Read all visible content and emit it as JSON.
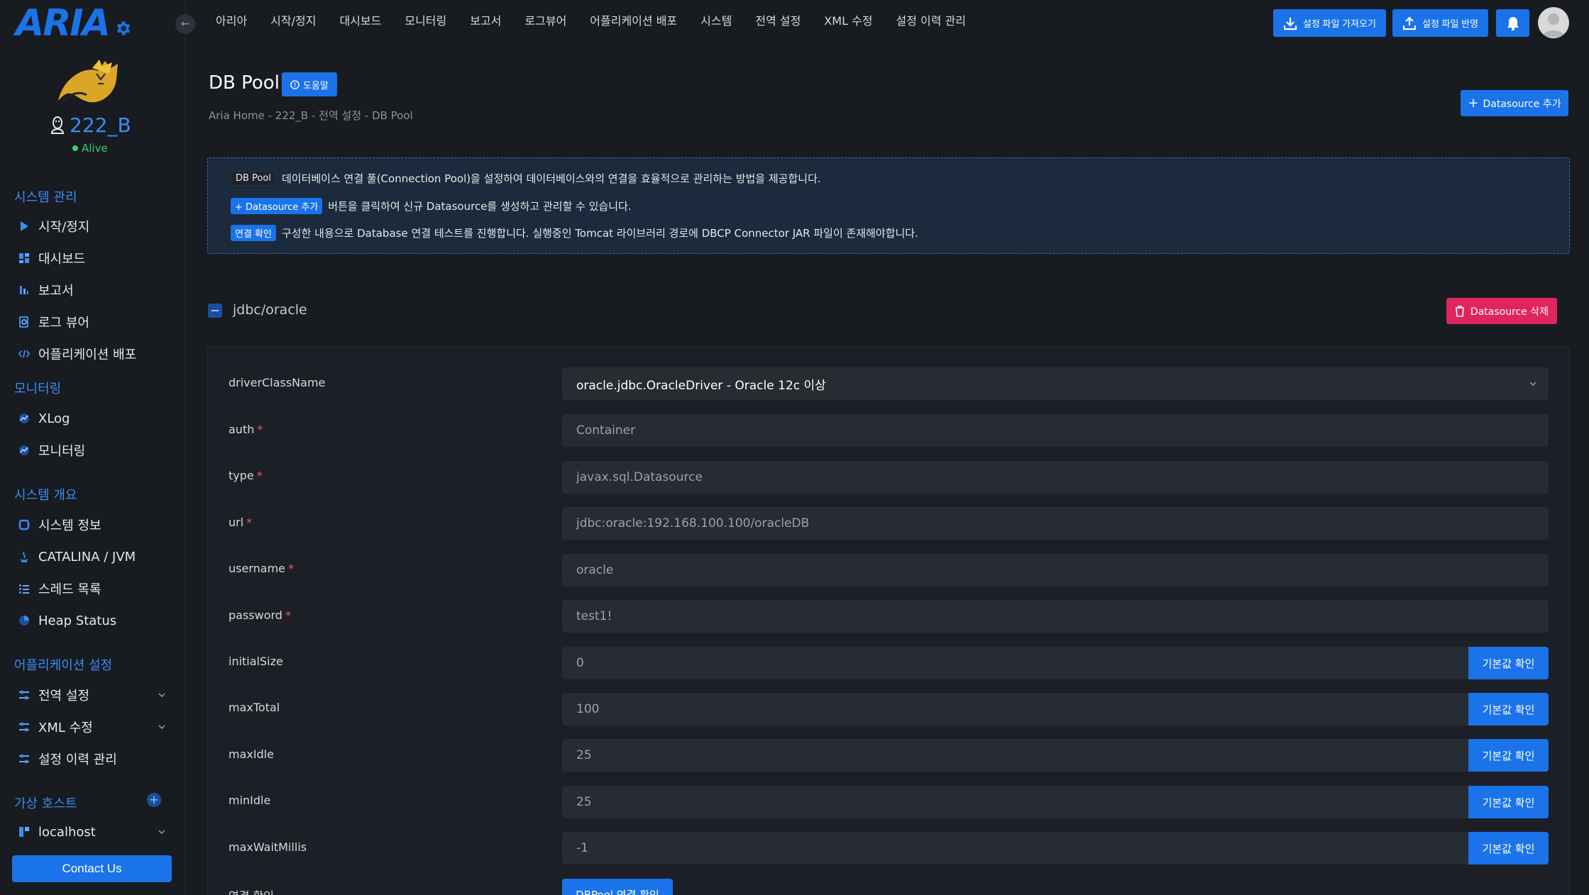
{
  "brand": {
    "logo_text": "ARIA"
  },
  "server": {
    "name": "222_B",
    "status": "Alive"
  },
  "sidebar": {
    "sections": [
      {
        "label": "시스템 관리"
      },
      {
        "label": "모니터링"
      },
      {
        "label": "시스템 개요"
      },
      {
        "label": "어플리케이션 설정"
      },
      {
        "label": "가상 호스트"
      }
    ],
    "items": [
      {
        "label": "시작/정지",
        "icon": "play-icon"
      },
      {
        "label": "대시보드",
        "icon": "dashboard-icon"
      },
      {
        "label": "보고서",
        "icon": "report-icon"
      },
      {
        "label": "로그 뷰어",
        "icon": "log-viewer-icon"
      },
      {
        "label": "어플리케이션 배포",
        "icon": "code-icon"
      },
      {
        "label": "XLog",
        "icon": "xlog-icon"
      },
      {
        "label": "모니터링",
        "icon": "monitoring-icon"
      },
      {
        "label": "시스템 정보",
        "icon": "chip-icon"
      },
      {
        "label": "CATALINA / JVM",
        "icon": "java-icon"
      },
      {
        "label": "스레드 목록",
        "icon": "thread-list-icon"
      },
      {
        "label": "Heap Status",
        "icon": "pie-icon"
      },
      {
        "label": "전역 설정",
        "icon": "sliders-icon"
      },
      {
        "label": "XML 수정",
        "icon": "sliders-icon"
      },
      {
        "label": "설정 이력 관리",
        "icon": "sliders-icon"
      },
      {
        "label": "localhost",
        "icon": "host-icon"
      }
    ],
    "contact_label": "Contact Us"
  },
  "topnav": {
    "items": [
      "아리아",
      "시작/정지",
      "대시보드",
      "모니터링",
      "보고서",
      "로그뷰어",
      "어플리케이션 배포",
      "시스템",
      "전역 설정",
      "XML 수정",
      "설정 이력 관리"
    ],
    "import_label": "설정 파일 가져오기",
    "apply_label": "설정 파일 반영"
  },
  "page": {
    "title": "DB Pool",
    "help_label": "도움말",
    "breadcrumb": "Aria Home  -  222_B  -  전역 설정  -  DB Pool",
    "add_datasource_label": "Datasource 추가"
  },
  "info": {
    "tag1": "DB Pool",
    "line1": "데이터베이스 연결 풀(Connection Pool)을 설정하여 데이터베이스와의 연결을 효율적으로 관리하는 방법을 제공합니다.",
    "tag2": "+ Datasource 추가",
    "line2": "버튼을 클릭하여 신규 Datasource를 생성하고 관리할 수 있습니다.",
    "tag3": "연결 확인",
    "line3": "구성한 내용으로 Database 연결 테스트를 진행합니다. 실행중인 Tomcat 라이브러리 경로에 DBCP Connector JAR 파일이 존재해야합니다."
  },
  "datasource": {
    "name": "jdbc/oracle",
    "delete_label": "Datasource 삭제",
    "fields": [
      {
        "label": "driverClassName",
        "value": "oracle.jdbc.OracleDriver - Oracle 12c 이상",
        "required": false
      },
      {
        "label": "auth",
        "value": "Container",
        "required": true
      },
      {
        "label": "type",
        "value": "javax.sql.Datasource",
        "required": true
      },
      {
        "label": "url",
        "value": "jdbc:oracle:192.168.100.100/oracleDB",
        "required": true
      },
      {
        "label": "username",
        "value": "oracle",
        "required": true
      },
      {
        "label": "password",
        "value": "test1!",
        "required": true
      },
      {
        "label": "initialSize",
        "value": "0",
        "required": false
      },
      {
        "label": "maxTotal",
        "value": "100",
        "required": false
      },
      {
        "label": "maxIdle",
        "value": "25",
        "required": false
      },
      {
        "label": "minIdle",
        "value": "25",
        "required": false
      },
      {
        "label": "maxWaitMillis",
        "value": "-1",
        "required": false
      }
    ],
    "default_label": "기본값 확인",
    "conn_label": "연결 확인",
    "conn_button_label": "DBPool 연결 확인"
  },
  "colors": {
    "accent": "#1a73e8",
    "danger": "#e0245e",
    "alive": "#3fc97c",
    "background": "#181b20"
  }
}
